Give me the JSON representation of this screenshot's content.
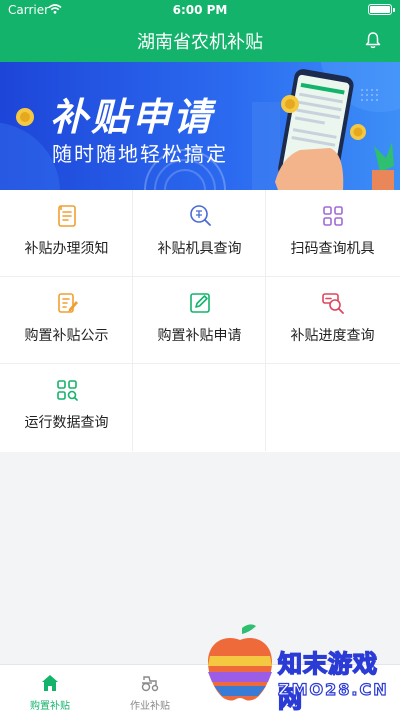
{
  "status": {
    "carrier": "Carrier",
    "time": "6:00 PM"
  },
  "header": {
    "title": "湖南省农机补贴"
  },
  "banner": {
    "title": "补贴申请",
    "subtitle": "随时随地轻松搞定"
  },
  "grid": [
    {
      "label": "补贴办理须知",
      "icon": "doc-list-icon",
      "color": "#f0a031"
    },
    {
      "label": "补贴机具查询",
      "icon": "search-subsidy-icon",
      "color": "#4a6ad6"
    },
    {
      "label": "扫码查询机具",
      "icon": "scan-grid-icon",
      "color": "#a06ad6"
    },
    {
      "label": "购置补贴公示",
      "icon": "notice-edit-icon",
      "color": "#f0a031"
    },
    {
      "label": "购置补贴申请",
      "icon": "edit-icon",
      "color": "#14b36b"
    },
    {
      "label": "补贴进度查询",
      "icon": "progress-search-icon",
      "color": "#e0455d"
    },
    {
      "label": "运行数据查询",
      "icon": "data-grid-search-icon",
      "color": "#14b36b"
    }
  ],
  "tabs": [
    {
      "label": "购置补贴",
      "active": true
    },
    {
      "label": "作业补贴",
      "active": false
    }
  ],
  "watermark": {
    "line1": "知末游戏网",
    "line2": "ZMO28.CN"
  },
  "colors": {
    "primary": "#14b36b",
    "banner": "#2c6cf1",
    "text": "#222222",
    "muted": "#888888"
  }
}
